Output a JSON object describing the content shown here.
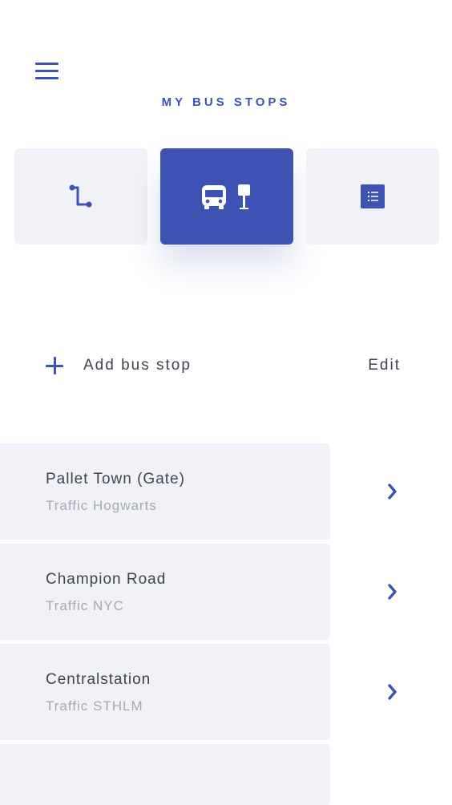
{
  "header": {
    "menu_icon": "hamburger-menu-icon",
    "title": "MY BUS STOPS"
  },
  "tabs": [
    {
      "icon": "route-icon",
      "active": false
    },
    {
      "icon": "bus-stop-icon",
      "active": true
    },
    {
      "icon": "list-icon",
      "active": false
    }
  ],
  "actions": {
    "add_label": "Add bus stop",
    "edit_label": "Edit"
  },
  "stops": [
    {
      "name": "Pallet Town (Gate)",
      "traffic": "Traffic Hogwarts"
    },
    {
      "name": "Champion Road",
      "traffic": "Traffic NYC"
    },
    {
      "name": "Centralstation",
      "traffic": "Traffic STHLM"
    }
  ],
  "colors": {
    "accent": "#3d52b2",
    "card_bg": "#f1f2f8",
    "text_primary": "#3f4350",
    "text_secondary": "#a5a8b4"
  }
}
